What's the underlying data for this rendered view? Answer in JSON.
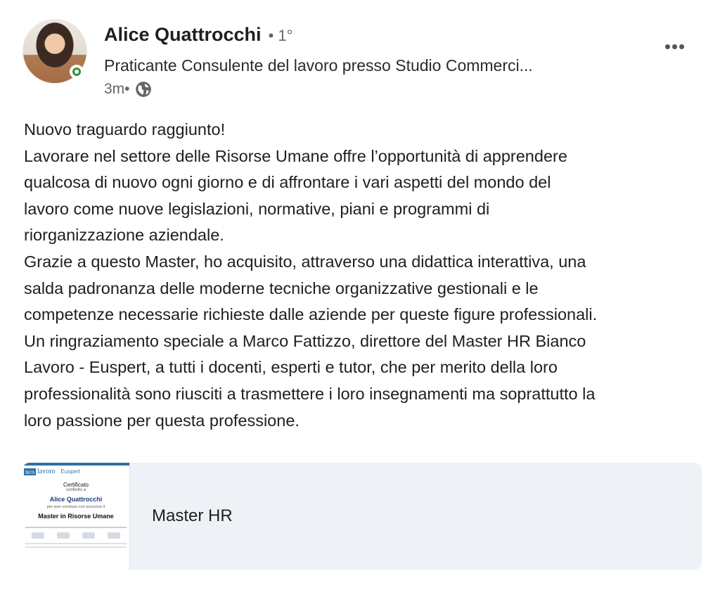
{
  "author": {
    "name": "Alice Quattrocchi",
    "degree": "• 1°",
    "headline": "Praticante Consulente del lavoro presso Studio Commerci...",
    "time": "3m•",
    "visibility_icon": "globe-icon",
    "presence": "online"
  },
  "post": {
    "lines": [
      "Nuovo traguardo raggiunto!",
      "Lavorare nel settore delle Risorse Umane offre l’opportunità di apprendere",
      "qualcosa di nuovo ogni giorno e di affrontare i vari aspetti del mondo del",
      "lavoro come nuove legislazioni, normative, piani e programmi di",
      "riorganizzazione aziendale.",
      "Grazie a questo Master, ho acquisito, attraverso una didattica interattiva, una",
      "salda padronanza delle moderne tecniche organizzative gestionali e le",
      "competenze necessarie richieste dalle aziende per queste figure professionali.",
      "Un ringraziamento speciale a Marco Fattizzo, direttore del Master HR Bianco",
      "Lavoro - Euspert, a tutti i docenti, esperti e tutor, che per merito della loro",
      "professionalità sono riusciti a trasmettere i loro insegnamenti ma soprattutto la",
      "loro passione per questa professione."
    ]
  },
  "attachment": {
    "title": "Master HR",
    "thumbnail": {
      "logo_left": "nco",
      "logo_left_rest": "lavoro",
      "logo_right": "Euspert",
      "heading": "Certificato",
      "conferred": "conferito a",
      "recipient": "Alice Quattrocchi",
      "completed": "per aver concluso con successo il",
      "course": "Master in Risorse Umane"
    }
  },
  "colors": {
    "presence_green": "#378f3d",
    "attachment_bg": "#eef1f5",
    "brand_blue": "#2f6fa5"
  },
  "controls": {
    "more_label": "•••"
  }
}
